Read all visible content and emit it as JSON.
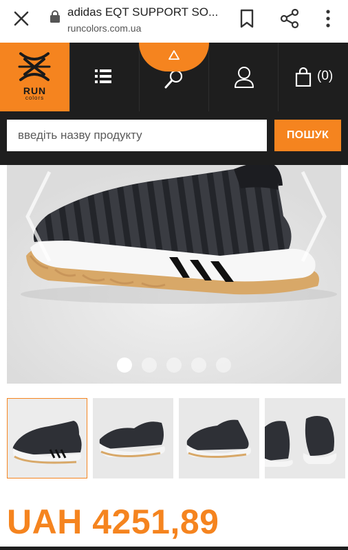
{
  "browser": {
    "page_title": "adidas EQT SUPPORT SO...",
    "url": "runcolors.com.ua",
    "icons": [
      "close-icon",
      "lock-icon",
      "bookmark-icon",
      "share-icon",
      "more-vert-icon"
    ]
  },
  "site": {
    "logo_text": "RUN",
    "logo_subtext": "colors",
    "cart_count": "(0)",
    "brand_color": "#f5841f",
    "header_color": "#1e1e1e"
  },
  "search": {
    "placeholder": "введіть назву продукту",
    "button_label": "ПОШУК"
  },
  "gallery": {
    "slide_count": 5,
    "active_slide": 1,
    "thumbnail_count": 4
  },
  "product": {
    "price": "UAH 4251,89"
  }
}
